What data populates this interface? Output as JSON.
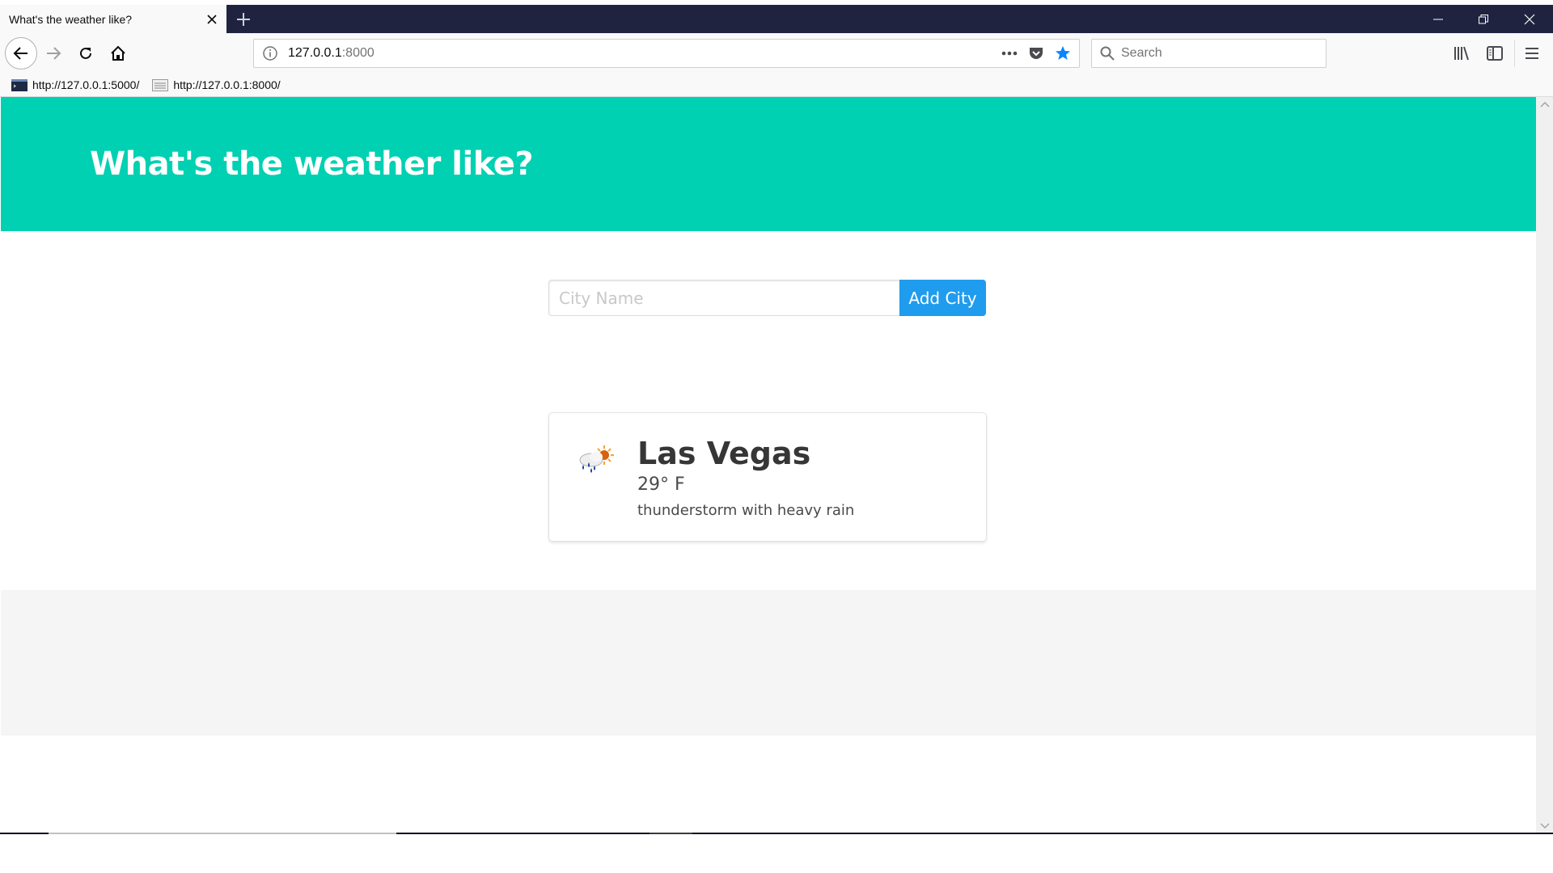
{
  "browser": {
    "tab": {
      "title": "What's the weather like?"
    },
    "url": {
      "host": "127.0.0.1",
      "port": ":8000"
    },
    "search": {
      "placeholder": "Search"
    },
    "bookmarks": [
      {
        "label": "http://127.0.0.1:5000/",
        "icon": "terminal-icon"
      },
      {
        "label": "http://127.0.0.1:8000/",
        "icon": "page-icon"
      }
    ],
    "colors": {
      "titlebar": "#202340",
      "bookmark_star": "#0a84ff"
    }
  },
  "page": {
    "hero": {
      "title": "What's the weather like?",
      "color": "#00d1b2"
    },
    "form": {
      "input_placeholder": "City Name",
      "input_value": "",
      "button_label": "Add City",
      "button_color": "#209cee"
    },
    "cards": [
      {
        "city": "Las Vegas",
        "temperature": "29° F",
        "description": "thunderstorm with heavy rain",
        "icon": "rain-sun-cloud-icon"
      }
    ]
  }
}
